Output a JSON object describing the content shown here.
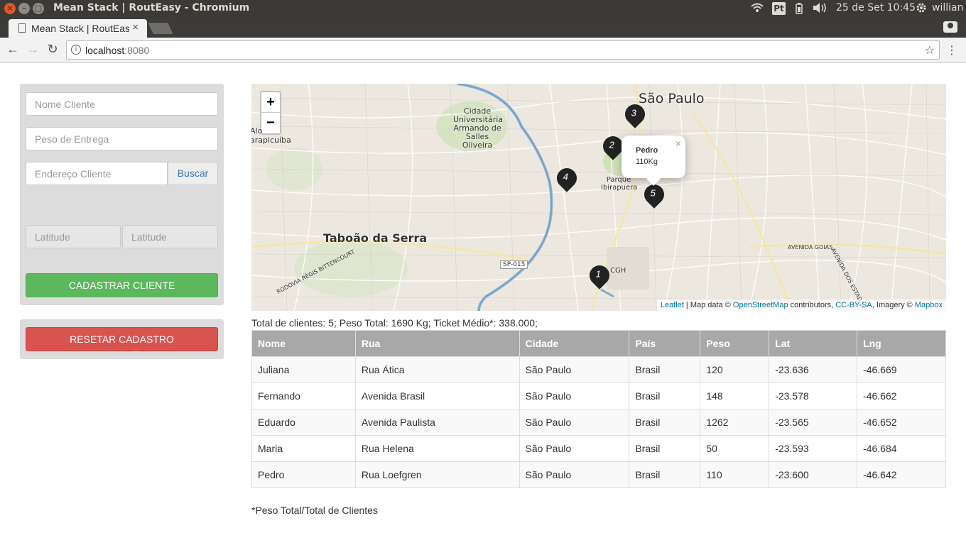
{
  "os": {
    "window_title": "Mean Stack | RoutEasy - Chromium",
    "datetime": "25 de Set 10:45",
    "user": "willian",
    "input_method": "Pt"
  },
  "browser": {
    "tab_title": "Mean Stack | RoutEasy",
    "url_host": "localhost",
    "url_port": ":8080"
  },
  "form": {
    "name_placeholder": "Nome Cliente",
    "weight_placeholder": "Peso de Entrega",
    "address_placeholder": "Endereço Cliente",
    "search_label": "Buscar",
    "lat_placeholder": "Latitude",
    "lng_placeholder": "Latitude",
    "submit_label": "CADASTRAR CLIENTE",
    "reset_label": "RESETAR CADASTRO"
  },
  "map": {
    "zoom_in": "+",
    "zoom_out": "−",
    "labels": {
      "sao_paulo": "São Paulo",
      "taboao": "Taboão da Serra",
      "cidade_univ": "Cidade Universitária Armando de Salles Oliveira",
      "alto": "Alo",
      "carapicuiba": "arapicuíba",
      "parque": "Parque Ibirapuera",
      "cgh": "CGH",
      "sp015": "SP-015",
      "avenida_goias": "AVENIDA GOIÁS",
      "avenida_estados": "AVENIDA DOS ESTADOS",
      "rodovia": "RODOVIA RÉGIS BITTENCOURT"
    },
    "markers": [
      "1",
      "2",
      "3",
      "4",
      "5"
    ],
    "popup": {
      "name": "Pedro",
      "value": "110Kg",
      "close": "×"
    },
    "attribution": {
      "leaflet": "Leaflet",
      "sep": " | Map data © ",
      "osm": "OpenStreetMap",
      "contrib": " contributors, ",
      "license": "CC-BY-SA",
      "imagery": ", Imagery © ",
      "mapbox": "Mapbox"
    }
  },
  "summary": "Total de clientes: 5; Peso Total: 1690 Kg; Ticket Médio*: 338.000;",
  "table": {
    "headers": [
      "Nome",
      "Rua",
      "Cidade",
      "País",
      "Peso",
      "Lat",
      "Lng"
    ],
    "rows": [
      [
        "Juliana",
        "Rua Ática",
        "São Paulo",
        "Brasil",
        "120",
        "-23.636",
        "-46.669"
      ],
      [
        "Fernando",
        "Avenida Brasil",
        "São Paulo",
        "Brasil",
        "148",
        "-23.578",
        "-46.662"
      ],
      [
        "Eduardo",
        "Avenida Paulista",
        "São Paulo",
        "Brasil",
        "1262",
        "-23.565",
        "-46.652"
      ],
      [
        "Maria",
        "Rua Helena",
        "São Paulo",
        "Brasil",
        "50",
        "-23.593",
        "-46.684"
      ],
      [
        "Pedro",
        "Rua Loefgren",
        "São Paulo",
        "Brasil",
        "110",
        "-23.600",
        "-46.642"
      ]
    ]
  },
  "footnote": "*Peso Total/Total de Clientes"
}
